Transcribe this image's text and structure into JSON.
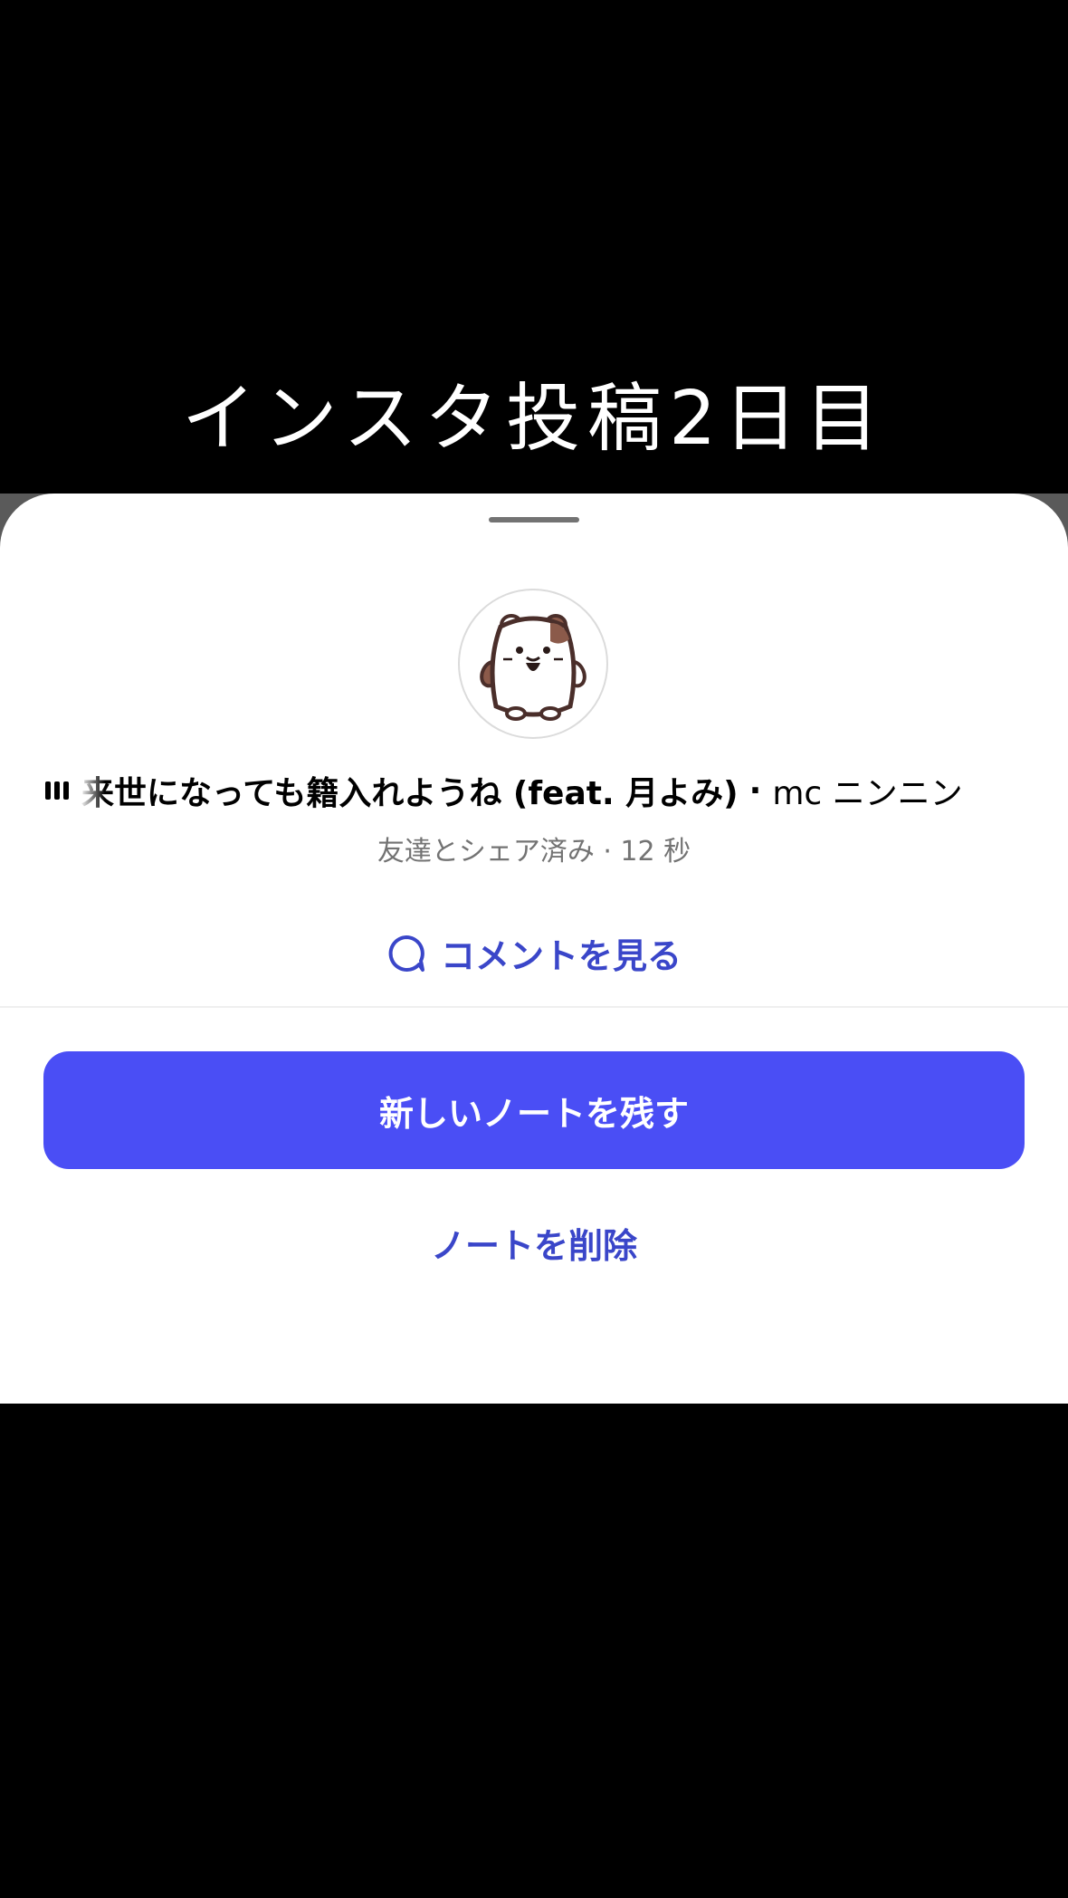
{
  "overlay": {
    "caption": "インスタ投稿2日目"
  },
  "sheet": {
    "track": {
      "title": "来世になっても籍入れようね (feat. 月よみ)",
      "separator": "·",
      "artist": "mc ニンニン"
    },
    "meta": "友達とシェア済み · 12 秒",
    "comments_label": "コメントを見る",
    "primary_button": "新しいノートを残す",
    "delete_label": "ノートを削除"
  },
  "colors": {
    "accent_text": "#3a46c9",
    "primary_button": "#4a4ef5",
    "secondary_text": "#737373"
  },
  "icons": {
    "now_playing": "audio-bars-icon",
    "comments": "speech-bubble-icon",
    "avatar": "hamster-avatar"
  }
}
